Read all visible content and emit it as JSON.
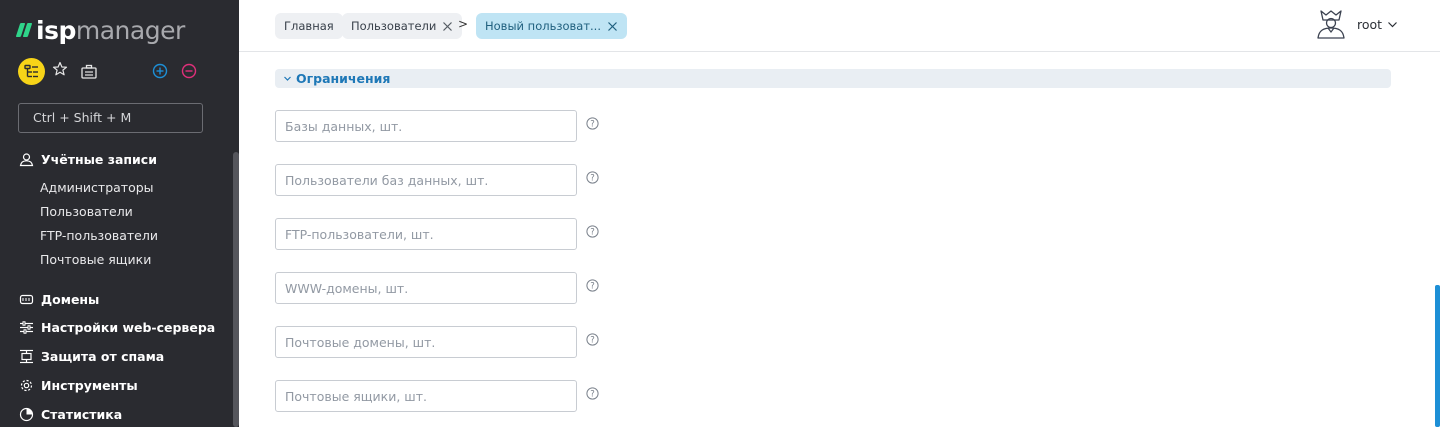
{
  "app": {
    "logo_primary": "isp",
    "logo_secondary": "manager"
  },
  "search": {
    "placeholder": "Ctrl + Shift + M"
  },
  "sidebar": {
    "groups": [
      {
        "label": "Учётные записи",
        "icon": "user-accounts-icon"
      },
      {
        "label": "Домены",
        "icon": "domains-icon"
      },
      {
        "label": "Настройки web-сервера",
        "icon": "sliders-icon"
      },
      {
        "label": "Защита от спама",
        "icon": "spam-protection-icon"
      },
      {
        "label": "Инструменты",
        "icon": "gear-icon"
      },
      {
        "label": "Статистика",
        "icon": "pie-chart-icon"
      }
    ],
    "account_items": [
      {
        "label": "Администраторы"
      },
      {
        "label": "Пользователи"
      },
      {
        "label": "FTP-пользователи"
      },
      {
        "label": "Почтовые ящики"
      }
    ]
  },
  "breadcrumbs": [
    {
      "label": "Главная"
    },
    {
      "label": "Пользователи"
    },
    {
      "label": "Новый пользоват..."
    }
  ],
  "breadcrumb_separator": ">",
  "user": {
    "name": "root"
  },
  "section": {
    "title": "Ограничения"
  },
  "fields": [
    {
      "placeholder": "Базы данных, шт.",
      "value": ""
    },
    {
      "placeholder": "Пользователи баз данных, шт.",
      "value": ""
    },
    {
      "placeholder": "FTP-пользователи, шт.",
      "value": ""
    },
    {
      "placeholder": "WWW-домены, шт.",
      "value": ""
    },
    {
      "placeholder": "Почтовые домены, шт.",
      "value": ""
    },
    {
      "placeholder": "Почтовые ящики, шт.",
      "value": ""
    }
  ],
  "colors": {
    "sidebar_bg": "#2a2b30",
    "logo_accent": "#2fd58a",
    "quick_action": "#f7d418",
    "plus_color": "#1d8fd6",
    "minus_color": "#e0307a",
    "section_title": "#1e78b7",
    "active_tab_bg": "#bfe4f4"
  }
}
